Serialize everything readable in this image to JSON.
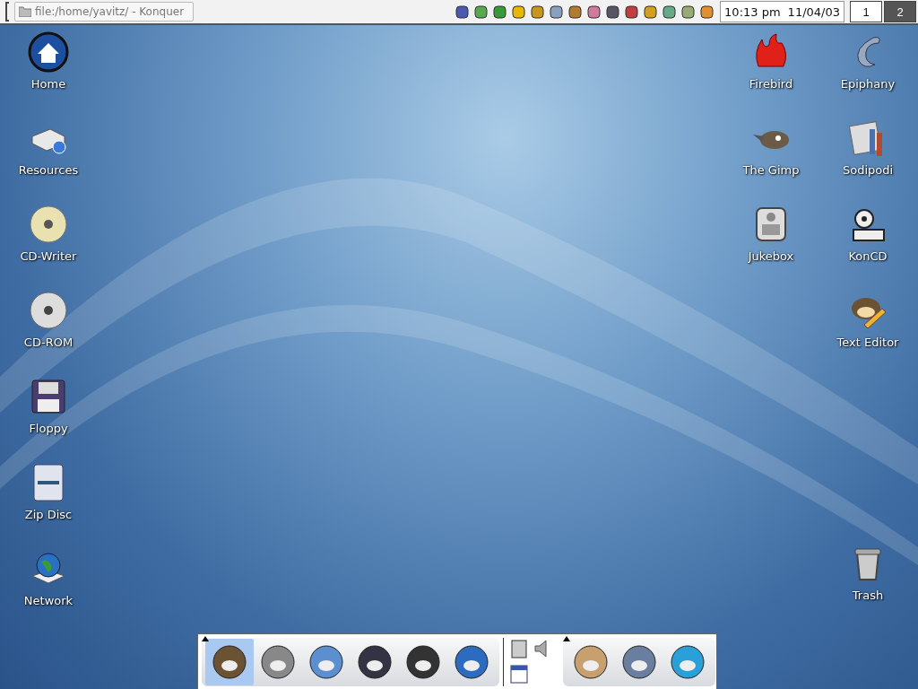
{
  "top_panel": {
    "task": {
      "title": "file:/home/yavitz/ - Konquer",
      "selected": false
    },
    "clock": {
      "time": "10:13 pm",
      "date": "11/04/03"
    },
    "pager": [
      {
        "label": "1",
        "selected": false
      },
      {
        "label": "2",
        "selected": true
      }
    ]
  },
  "desktop": {
    "left_icons": [
      {
        "label": "Home"
      },
      {
        "label": "Resources"
      },
      {
        "label": "CD-Writer"
      },
      {
        "label": "CD-ROM"
      },
      {
        "label": "Floppy"
      },
      {
        "label": "Zip Disc"
      },
      {
        "label": "Network"
      }
    ],
    "right_column_1": [
      {
        "label": "Firebird"
      },
      {
        "label": "The Gimp"
      },
      {
        "label": "Jukebox"
      }
    ],
    "right_column_2": [
      {
        "label": "Epiphany"
      },
      {
        "label": "Sodipodi"
      },
      {
        "label": "KonCD"
      },
      {
        "label": "Text Editor"
      }
    ],
    "trash": {
      "label": "Trash"
    }
  },
  "dock": {
    "groups": [
      {
        "kind": "launchers",
        "items": [
          {
            "selected": true
          },
          {
            "selected": false
          },
          {
            "selected": false
          },
          {
            "selected": false
          },
          {
            "selected": false
          },
          {
            "selected": false
          }
        ]
      },
      {
        "kind": "applet"
      },
      {
        "kind": "launchers",
        "items": [
          {
            "selected": false
          },
          {
            "selected": false
          },
          {
            "selected": false
          }
        ]
      }
    ]
  }
}
